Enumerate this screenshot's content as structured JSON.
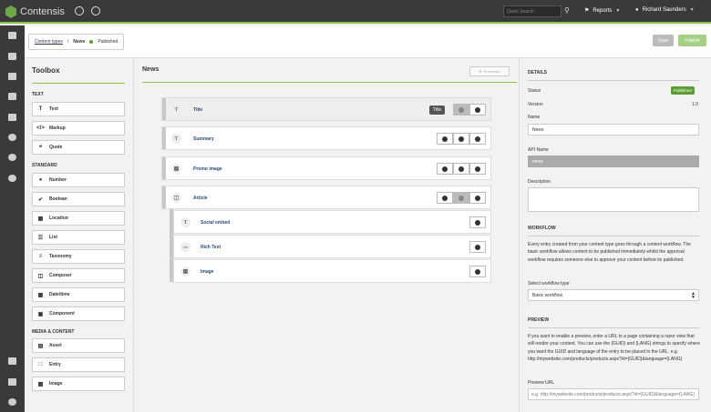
{
  "app": {
    "title": "Contensis"
  },
  "topbar": {
    "search_placeholder": "Quick Search",
    "reports_label": "Reports",
    "user_name": "Richard Saunders"
  },
  "header": {
    "breadcrumb_link": "Content types",
    "breadcrumb_sep": "/",
    "breadcrumb_current": "News",
    "status": "Published",
    "save_label": "Save",
    "publish_label": "Publish"
  },
  "toolbox": {
    "title": "Toolbox",
    "sections": [
      {
        "label": "TEXT",
        "items": [
          {
            "label": "Text",
            "icon": "text-icon"
          },
          {
            "label": "Markup",
            "icon": "markup-icon"
          },
          {
            "label": "Quote",
            "icon": "quote-icon"
          }
        ]
      },
      {
        "label": "STANDARD",
        "items": [
          {
            "label": "Number",
            "icon": "number-icon"
          },
          {
            "label": "Boolean",
            "icon": "check-icon"
          },
          {
            "label": "Location",
            "icon": "map-icon"
          },
          {
            "label": "List",
            "icon": "list-icon"
          },
          {
            "label": "Taxonomy",
            "icon": "taxonomy-icon"
          },
          {
            "label": "Composer",
            "icon": "composer-icon"
          },
          {
            "label": "Date/time",
            "icon": "calendar-icon"
          },
          {
            "label": "Component",
            "icon": "component-icon"
          }
        ]
      },
      {
        "label": "MEDIA & CONTENT",
        "items": [
          {
            "label": "Asset",
            "icon": "asset-icon"
          },
          {
            "label": "Entry",
            "icon": "entry-icon"
          },
          {
            "label": "Image",
            "icon": "image-icon"
          }
        ]
      }
    ]
  },
  "main": {
    "title": "News",
    "properties_label": "Properties",
    "title_tag": "Title",
    "fields": [
      {
        "name": "Title",
        "icon": "text-icon"
      },
      {
        "name": "Summary",
        "icon": "text-icon"
      },
      {
        "name": "Promo image",
        "icon": "image-icon"
      },
      {
        "name": "Article",
        "icon": "composer-icon"
      }
    ],
    "article_children": [
      {
        "name": "Social embed",
        "icon": "text-icon"
      },
      {
        "name": "Rich Text",
        "icon": "markup-icon"
      },
      {
        "name": "Image",
        "icon": "image-icon"
      }
    ]
  },
  "details": {
    "heading": "DETAILS",
    "status_label": "Status",
    "status_value": "Published",
    "version_label": "Version",
    "version_value": "1.0",
    "name_label": "Name",
    "name_value": "News",
    "api_label": "API Name",
    "api_value": "news",
    "description_label": "Description",
    "workflow_heading": "WORKFLOW",
    "workflow_text": "Every entry created from your content type goes through a content workflow. The basic workflow allows content to be published immediately whilst the approval workflow requires someone else to approve your content before its published.",
    "workflow_select_label": "Select workflow type",
    "workflow_select_value": "Basic workflow",
    "preview_heading": "PREVIEW",
    "preview_text": "If you want to enable a preview, enter a URL to a page containing a razor view that will render your content. You can use the {GUID} and {LANG} strings to specify where you want the GUID and language of the entry to be placed in the URL.  e.g. http://mywebsite.com/products/products.aspx?id={GUID}&language={LANG}",
    "preview_url_label": "Preview URL",
    "preview_url_placeholder": "e.g. http://mywebsite.com/products/products.aspx?id={GUID}&language={LANG}"
  },
  "colors": {
    "accent": "#8bc34a",
    "published": "#5a9e2f",
    "topbar": "#3a3a3a"
  }
}
